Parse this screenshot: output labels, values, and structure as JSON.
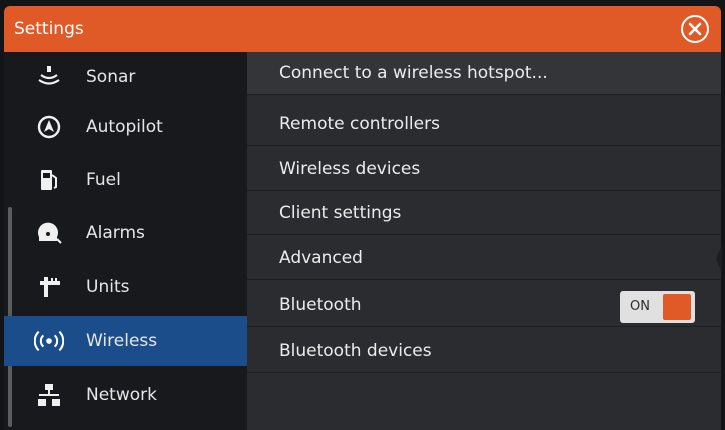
{
  "window": {
    "title": "Settings"
  },
  "sidebar": {
    "items": [
      {
        "label": "Sonar",
        "icon": "sonar-icon"
      },
      {
        "label": "Autopilot",
        "icon": "autopilot-icon"
      },
      {
        "label": "Fuel",
        "icon": "fuel-pump-icon"
      },
      {
        "label": "Alarms",
        "icon": "alarm-icon"
      },
      {
        "label": "Units",
        "icon": "units-icon"
      },
      {
        "label": "Wireless",
        "icon": "wireless-icon",
        "selected": true
      },
      {
        "label": "Network",
        "icon": "network-icon"
      }
    ]
  },
  "wireless": {
    "rows": [
      {
        "label": "Connect to a wireless hotspot..."
      },
      {
        "label": "Remote controllers"
      },
      {
        "label": "Wireless devices"
      },
      {
        "label": "Client settings"
      },
      {
        "label": "Advanced"
      },
      {
        "label": "Bluetooth",
        "toggle": "ON"
      },
      {
        "label": "Bluetooth devices"
      }
    ]
  },
  "colors": {
    "accent": "#e05a28",
    "selection": "#1a4d8a",
    "panel": "#2a2c2f",
    "sidebar": "#17191c"
  }
}
